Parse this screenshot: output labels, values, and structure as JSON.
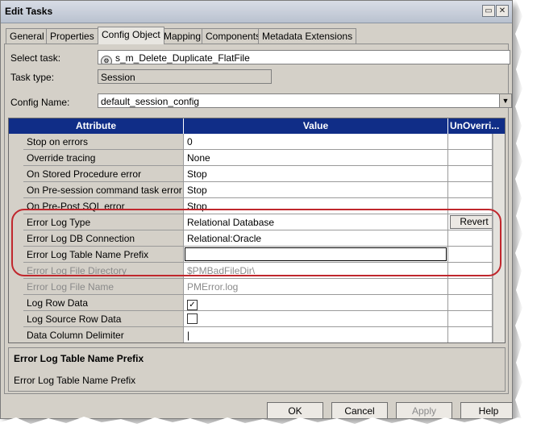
{
  "window": {
    "title": "Edit Tasks"
  },
  "tabs": [
    {
      "label": "General"
    },
    {
      "label": "Properties"
    },
    {
      "label": "Config Object",
      "active": true
    },
    {
      "label": "Mapping"
    },
    {
      "label": "Components"
    },
    {
      "label": "Metadata Extensions"
    }
  ],
  "form": {
    "select_task_label": "Select task:",
    "select_task_value": "s_m_Delete_Duplicate_FlatFile",
    "task_type_label": "Task type:",
    "task_type_value": "Session",
    "config_name_label": "Config Name:",
    "config_name_value": "default_session_config"
  },
  "grid": {
    "headers": {
      "attribute": "Attribute",
      "value": "Value",
      "unoverride": "UnOverri..."
    },
    "rows": [
      {
        "attribute": "Stop on errors",
        "value": "0"
      },
      {
        "attribute": "Override tracing",
        "value": "None"
      },
      {
        "attribute": "On Stored Procedure error",
        "value": "Stop"
      },
      {
        "attribute": "On Pre-session command task error",
        "value": "Stop"
      },
      {
        "attribute": "On Pre-Post SQL error",
        "value": "Stop"
      },
      {
        "attribute": "Error Log Type",
        "value": "Relational Database",
        "unoverride": "Revert"
      },
      {
        "attribute": "Error Log DB Connection",
        "value": "Relational:Oracle"
      },
      {
        "attribute": "Error Log Table Name Prefix",
        "value": ""
      },
      {
        "attribute": "Error Log File Directory",
        "value": "$PMBadFileDir\\",
        "disabled": true
      },
      {
        "attribute": "Error Log File Name",
        "value": "PMError.log",
        "disabled": true
      },
      {
        "attribute": "Log Row Data",
        "checked": true
      },
      {
        "attribute": "Log Source Row Data",
        "checked": false
      },
      {
        "attribute": "Data Column Delimiter",
        "value": "|"
      }
    ]
  },
  "description": {
    "title": "Error Log Table Name Prefix",
    "text": "Error Log Table Name Prefix"
  },
  "buttons": {
    "ok": "OK",
    "cancel": "Cancel",
    "apply": "Apply",
    "help": "Help"
  },
  "colors": {
    "header_bg": "#102d87",
    "highlight": "#c0272d"
  }
}
